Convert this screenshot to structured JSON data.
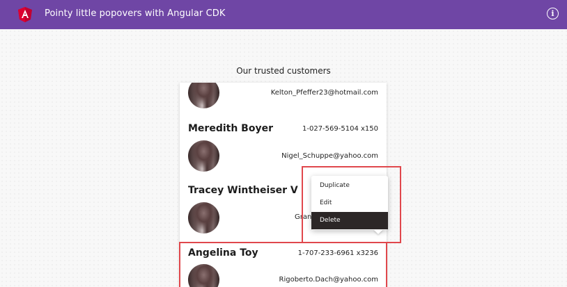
{
  "toolbar": {
    "title": "Pointy little popovers with Angular CDK",
    "logo_icon": "angular-logo-icon",
    "info_icon": "info-icon",
    "info_glyph": "i",
    "background": "#6f46a5"
  },
  "section": {
    "title": "Our trusted customers"
  },
  "customers": [
    {
      "name": "",
      "phone": "",
      "email": "Kelton_Pfeffer23@hotmail.com"
    },
    {
      "name": "Meredith Boyer",
      "phone": "1-027-569-5104 x150",
      "email": "Nigel_Schuppe@yahoo.com"
    },
    {
      "name": "Tracey Wintheiser V",
      "phone": "",
      "email": "Granv"
    },
    {
      "name": "Angelina Toy",
      "phone": "1-707-233-6961 x3236",
      "email": "Rigoberto.Dach@yahoo.com"
    }
  ],
  "menu": {
    "items": [
      "Duplicate",
      "Edit",
      "Delete"
    ],
    "active_item": "Delete"
  },
  "highlight_color": "#e0474c"
}
